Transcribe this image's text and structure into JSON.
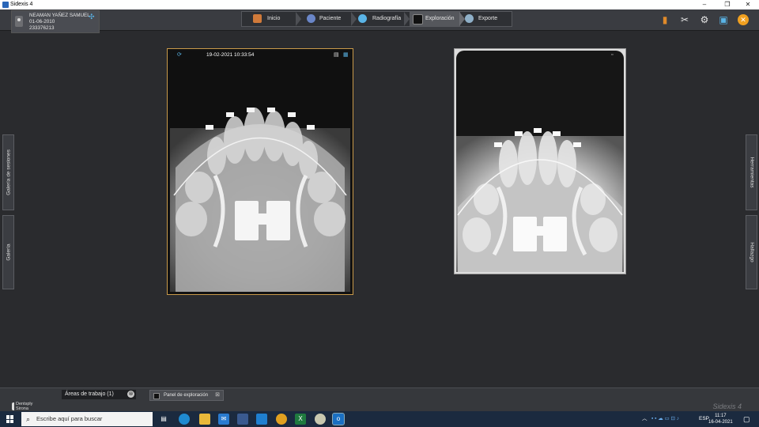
{
  "window": {
    "title": "Sidexis 4",
    "buttons": [
      "–",
      "❐",
      "✕"
    ]
  },
  "patient": {
    "name": "NEAMAN YAÑEZ SAMUEL",
    "birthdate": "01-06-2010",
    "id": "233376213"
  },
  "workflow": {
    "steps": [
      {
        "label": "Inicio",
        "icon": "home-icon",
        "color": "#d07a3a"
      },
      {
        "label": "Paciente",
        "icon": "patient-icon",
        "color": "#6a86c8"
      },
      {
        "label": "Radiografía",
        "icon": "xray-scan-icon",
        "color": "#5ab4e6"
      },
      {
        "label": "Exploración",
        "icon": "exploration-icon",
        "color": "#111111"
      },
      {
        "label": "Exporte",
        "icon": "export-icon",
        "color": "#8fb0c8"
      }
    ],
    "active": "Exploración"
  },
  "toolbar": {
    "icons": [
      {
        "name": "book-icon",
        "glyph": "▮",
        "color": "#e08a2a"
      },
      {
        "name": "tools-icon",
        "glyph": "✂",
        "color": "#e6e6e6"
      },
      {
        "name": "settings-icon",
        "glyph": "⚙",
        "color": "#e6e6e6"
      },
      {
        "name": "monitor-icon",
        "glyph": "▣",
        "color": "#5ab4e6"
      },
      {
        "name": "close-session-icon",
        "glyph": "✕",
        "color": "#f0a020"
      }
    ]
  },
  "sidebars": {
    "left": [
      "Galería de sesiones",
      "Galería"
    ],
    "right": [
      "Herramientas",
      "Hallazgo"
    ]
  },
  "images": [
    {
      "timestamp": "19-02-2021 10:33:54",
      "selected": true
    },
    {
      "timestamp": "",
      "selected": false
    }
  ],
  "bottom": {
    "logo_lines": [
      "Dentsply",
      "Sirona"
    ],
    "workareas": "Áreas de trabajo (1)",
    "panel": "Panel de exploración",
    "brand": "Sidexis 4"
  },
  "taskbar": {
    "search_placeholder": "Escribe aquí para buscar",
    "apps": [
      {
        "name": "task-view-icon",
        "color": "#3a4a5f"
      },
      {
        "name": "edge-icon",
        "color": "#1f8ad0"
      },
      {
        "name": "file-explorer-icon",
        "color": "#e8b83a"
      },
      {
        "name": "mail-icon",
        "color": "#2a7bd0"
      },
      {
        "name": "store-icon",
        "color": "#3a5a8f"
      },
      {
        "name": "chrome-icon",
        "color": "#e0a020"
      },
      {
        "name": "excel-icon",
        "color": "#1f7a3f"
      },
      {
        "name": "sidexis-icon",
        "color": "#c8c8b0"
      },
      {
        "name": "outlook-icon",
        "color": "#1a6fc2"
      }
    ],
    "language": "ESP",
    "time": "11:17",
    "date": "16-04-2021"
  }
}
